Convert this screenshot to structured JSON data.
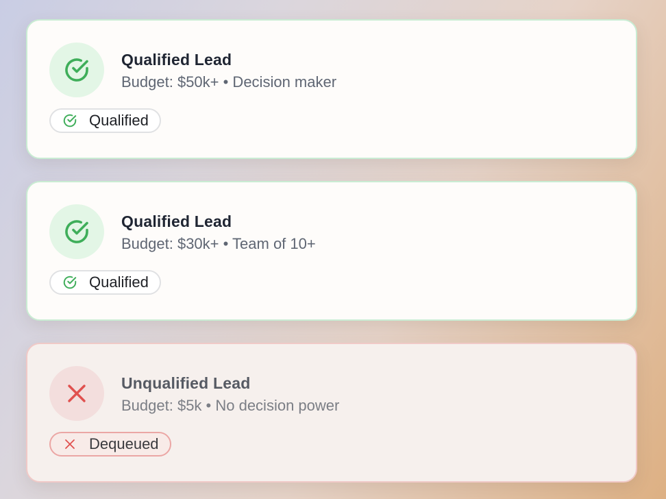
{
  "leads": [
    {
      "status": "qualified",
      "title": "Qualified Lead",
      "subtitle": "Budget: $50k+ • Decision maker",
      "badge": "Qualified",
      "icon": "check-circle-icon"
    },
    {
      "status": "qualified",
      "title": "Qualified Lead",
      "subtitle": "Budget: $30k+ • Team of 10+",
      "badge": "Qualified",
      "icon": "check-circle-icon"
    },
    {
      "status": "unqualified",
      "title": "Unqualified Lead",
      "subtitle": "Budget: $5k • No decision power",
      "badge": "Dequeued",
      "icon": "x-icon"
    }
  ],
  "colors": {
    "qualified_accent": "#3fae5a",
    "unqualified_accent": "#e0504e"
  }
}
